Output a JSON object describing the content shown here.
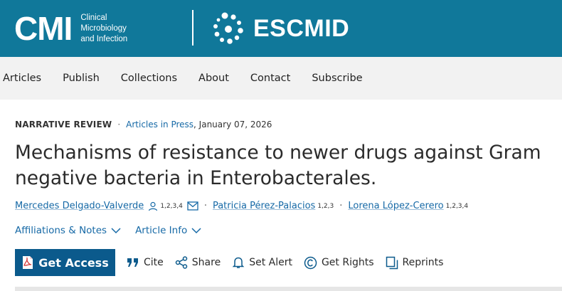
{
  "header": {
    "logo_mark": "CMI",
    "logo_subtitle": [
      "Clinical",
      "Microbiology",
      "and Infection"
    ],
    "partner": "ESCMID"
  },
  "nav": {
    "items": [
      "Articles",
      "Publish",
      "Collections",
      "About",
      "Contact",
      "Subscribe"
    ]
  },
  "article": {
    "type": "NARRATIVE REVIEW",
    "status": "Articles in Press",
    "date": ", January 07, 2026",
    "title": "Mechanisms of resistance to newer drugs against Gram negative bacteria in Enterobacterales.",
    "authors": [
      {
        "name": "Mercedes Delgado-Valverde",
        "affil": "1,2,3,4"
      },
      {
        "name": "Patricia Pérez-Palacios",
        "affil": "1,2,3"
      },
      {
        "name": "Lorena López-Cerero",
        "affil": "1,2,3,4"
      }
    ],
    "affiliations_label": "Affiliations & Notes",
    "article_info_label": "Article Info"
  },
  "actions": {
    "get_access": "Get Access",
    "cite": "Cite",
    "share": "Share",
    "set_alert": "Set Alert",
    "get_rights": "Get Rights",
    "reprints": "Reprints"
  },
  "colors": {
    "banner": "#10789a",
    "link": "#1669a6",
    "button": "#0b5a8c"
  }
}
